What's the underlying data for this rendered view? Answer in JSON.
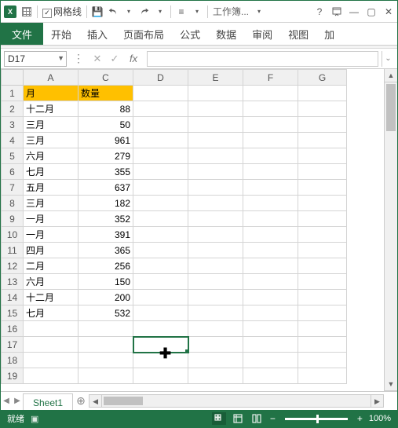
{
  "titlebar": {
    "gridlines": "网格线",
    "workbook": "工作簿..."
  },
  "ribbon": {
    "file": "文件",
    "tabs": [
      "开始",
      "插入",
      "页面布局",
      "公式",
      "数据",
      "审阅",
      "视图",
      "加"
    ]
  },
  "namebox": {
    "ref": "D17"
  },
  "columns": [
    "A",
    "C",
    "D",
    "E",
    "F",
    "G"
  ],
  "rows": [
    "1",
    "2",
    "3",
    "4",
    "5",
    "6",
    "7",
    "8",
    "9",
    "10",
    "11",
    "12",
    "13",
    "14",
    "15",
    "16",
    "17",
    "18",
    "19"
  ],
  "headers": {
    "A": "月",
    "C": "数量"
  },
  "data": [
    {
      "m": "十二月",
      "v": "88"
    },
    {
      "m": "三月",
      "v": "50"
    },
    {
      "m": "三月",
      "v": "961"
    },
    {
      "m": "六月",
      "v": "279"
    },
    {
      "m": "七月",
      "v": "355"
    },
    {
      "m": "五月",
      "v": "637"
    },
    {
      "m": "三月",
      "v": "182"
    },
    {
      "m": "一月",
      "v": "352"
    },
    {
      "m": "一月",
      "v": "391"
    },
    {
      "m": "四月",
      "v": "365"
    },
    {
      "m": "二月",
      "v": "256"
    },
    {
      "m": "六月",
      "v": "150"
    },
    {
      "m": "十二月",
      "v": "200"
    },
    {
      "m": "七月",
      "v": "532"
    }
  ],
  "sheet": {
    "tab": "Sheet1"
  },
  "status": {
    "ready": "就绪",
    "zoom": "100%"
  }
}
